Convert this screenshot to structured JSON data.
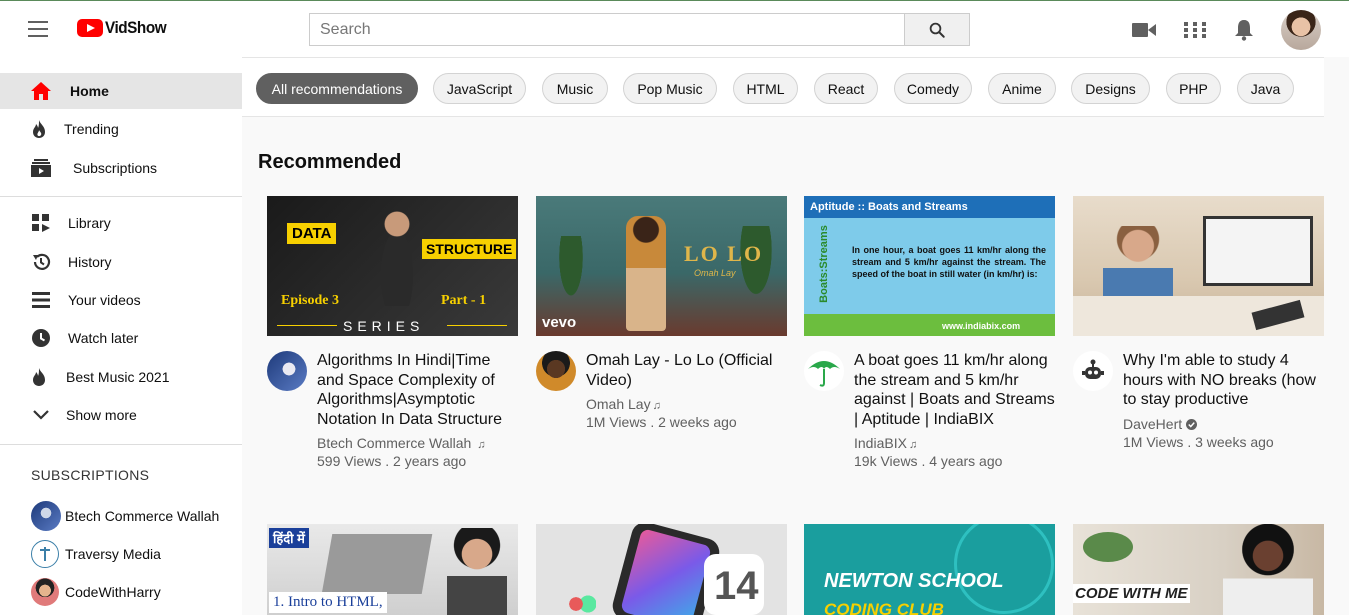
{
  "header": {
    "logo_text": "VidShow",
    "search_placeholder": "Search",
    "icons": [
      "menu-icon",
      "video-camera-icon",
      "apps-grid-icon",
      "bell-icon"
    ]
  },
  "sidebar": {
    "main_items": [
      {
        "label": "Home",
        "icon": "home-icon",
        "active": true
      },
      {
        "label": "Trending",
        "icon": "fire-icon"
      },
      {
        "label": "Subscriptions",
        "icon": "subscriptions-icon"
      }
    ],
    "library_items": [
      {
        "label": "Library",
        "icon": "library-icon"
      },
      {
        "label": "History",
        "icon": "history-icon"
      },
      {
        "label": "Your videos",
        "icon": "your-videos-icon"
      },
      {
        "label": "Watch later",
        "icon": "clock-icon"
      },
      {
        "label": "Best Music 2021",
        "icon": "playlist-icon"
      },
      {
        "label": "Show more",
        "icon": "chevron-down-icon"
      }
    ],
    "subscriptions_heading": "SUBSCRIPTIONS",
    "subscriptions": [
      {
        "name": "Btech Commerce Wallah"
      },
      {
        "name": "Traversy Media"
      },
      {
        "name": "CodeWithHarry"
      }
    ]
  },
  "chips": [
    "All recommendations",
    "JavaScript",
    "Music",
    "Pop Music",
    "HTML",
    "React",
    "Comedy",
    "Anime",
    "Designs",
    "PHP",
    "Java"
  ],
  "main": {
    "section_title": "Recommended"
  },
  "videos": [
    {
      "title": "Algorithms In Hindi|Time and Space Complexity of Algorithms|Asymptotic Notation In Data Structure",
      "channel": "Btech Commerce Wallah",
      "channel_badge": "music-note",
      "views": "599 Views",
      "age": "2 years ago",
      "thumb_text": {
        "t1": "DATA",
        "t2": "STRUCTURE",
        "t3": "Episode 3",
        "t4": "Part - 1",
        "t5": "SERIES"
      }
    },
    {
      "title": "Omah Lay - Lo Lo (Official Video)",
      "channel": "Omah Lay",
      "channel_badge": "music-note",
      "views": "1M Views",
      "age": "2 weeks ago",
      "thumb_text": {
        "t1": "LO LO",
        "t2": "Omah Lay",
        "t3": "vevo"
      }
    },
    {
      "title": "A boat goes 11 km/hr along the stream and 5 km/hr against | Boats and Streams | Aptitude | IndiaBIX",
      "channel": "IndiaBIX",
      "channel_badge": "music-note",
      "views": "19k Views",
      "age": "4 years ago",
      "thumb_text": {
        "t1": "Aptitude :: Boats and Streams",
        "t2": "In one hour, a boat goes 11 km/hr along the stream and 5 km/hr against the stream. The speed of the boat in still water (in km/hr) is:",
        "t3": "Boats:Streams",
        "t4": "www.indiabix.com"
      }
    },
    {
      "title": "Why I'm able to study 4 hours with NO breaks (how to stay productive",
      "channel": "DaveHert",
      "channel_badge": "verified",
      "views": "1M Views",
      "age": "3 weeks ago",
      "thumb_text": {}
    }
  ],
  "videos_row2": [
    {
      "thumb_text": {
        "t1": "हिंदी में",
        "t2": "1. Intro to HTML,"
      }
    },
    {
      "thumb_text": {
        "t1": "14"
      }
    },
    {
      "thumb_text": {
        "t1": "NEWTON SCHOOL",
        "t2": "CODING CLUB"
      }
    },
    {
      "thumb_text": {
        "t1": "CODE WITH ME"
      }
    }
  ],
  "colors": {
    "accent": "#ff0000",
    "chip_active": "#606060",
    "meta_text": "#606060"
  }
}
